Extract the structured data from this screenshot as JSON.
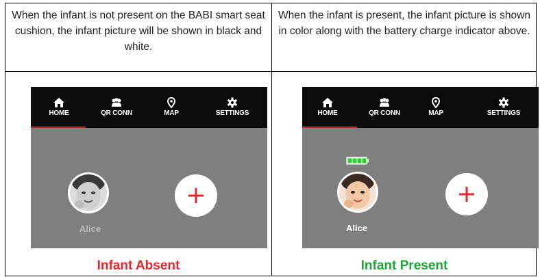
{
  "left": {
    "description": "When the infant is not present on the BABI smart seat cushion, the infant picture will be shown in black and white.",
    "caption": "Infant Absent",
    "caption_color": "#e8262c",
    "avatar_style": "grayscale",
    "child_name": "Alice",
    "battery_visible": false
  },
  "right": {
    "description": "When the infant is present, the infant picture is shown in color along with the battery charge indicator above.",
    "caption": "Infant Present",
    "caption_color": "#1fa33a",
    "avatar_style": "color",
    "child_name": "Alice",
    "battery_visible": true,
    "battery_level": 1.0
  },
  "nav": {
    "home": "HOME",
    "qr": "QR CONN",
    "map": "MAP",
    "settings": "SETTINGS",
    "active": "HOME",
    "icons": [
      "home-icon",
      "people-icon",
      "map-pin-icon",
      "gear-icon"
    ]
  },
  "colors": {
    "nav_bg": "#0b0b0b",
    "active_tab_underline": "#d0232a",
    "screen_bg": "#7f7f7f",
    "plus_sign": "#e8262c",
    "battery": "#33cc33"
  }
}
